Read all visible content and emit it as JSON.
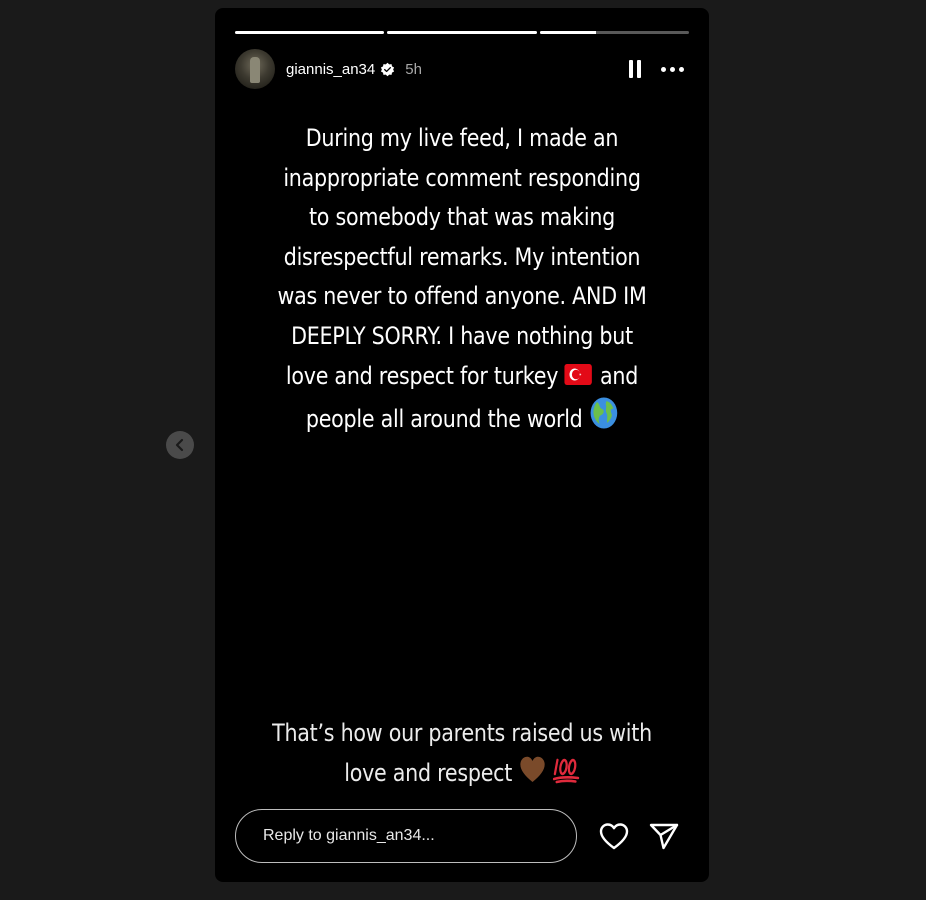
{
  "story": {
    "username": "giannis_an34",
    "time_ago": "5h",
    "progress": [
      1,
      1,
      0.38
    ],
    "caption_lines": [
      "During my live feed, I made an",
      "inappropriate comment responding",
      "to somebody that was making",
      "disrespectful remarks. My intention",
      "was never to offend anyone. AND IM",
      "DEEPLY SORRY. I have nothing but",
      "love and respect for turkey",
      "and",
      "people all around the world"
    ],
    "footer_lines": [
      "That’s how our parents raised us with",
      "love and respect"
    ],
    "reply_placeholder": "Reply to giannis_an34..."
  },
  "icons": {
    "prev": "chevron-left-icon",
    "verified": "verified-badge-icon",
    "pause": "pause-icon",
    "more": "more-options-icon",
    "like": "heart-icon",
    "share": "send-icon",
    "flag": "turkey-flag-emoji",
    "globe": "globe-emoji",
    "heart_emoji": "brown-heart-emoji",
    "hundred": "hundred-points-emoji"
  },
  "colors": {
    "background": "#1a1a1a",
    "story_bg": "#000000",
    "verified": "#ffffff"
  }
}
